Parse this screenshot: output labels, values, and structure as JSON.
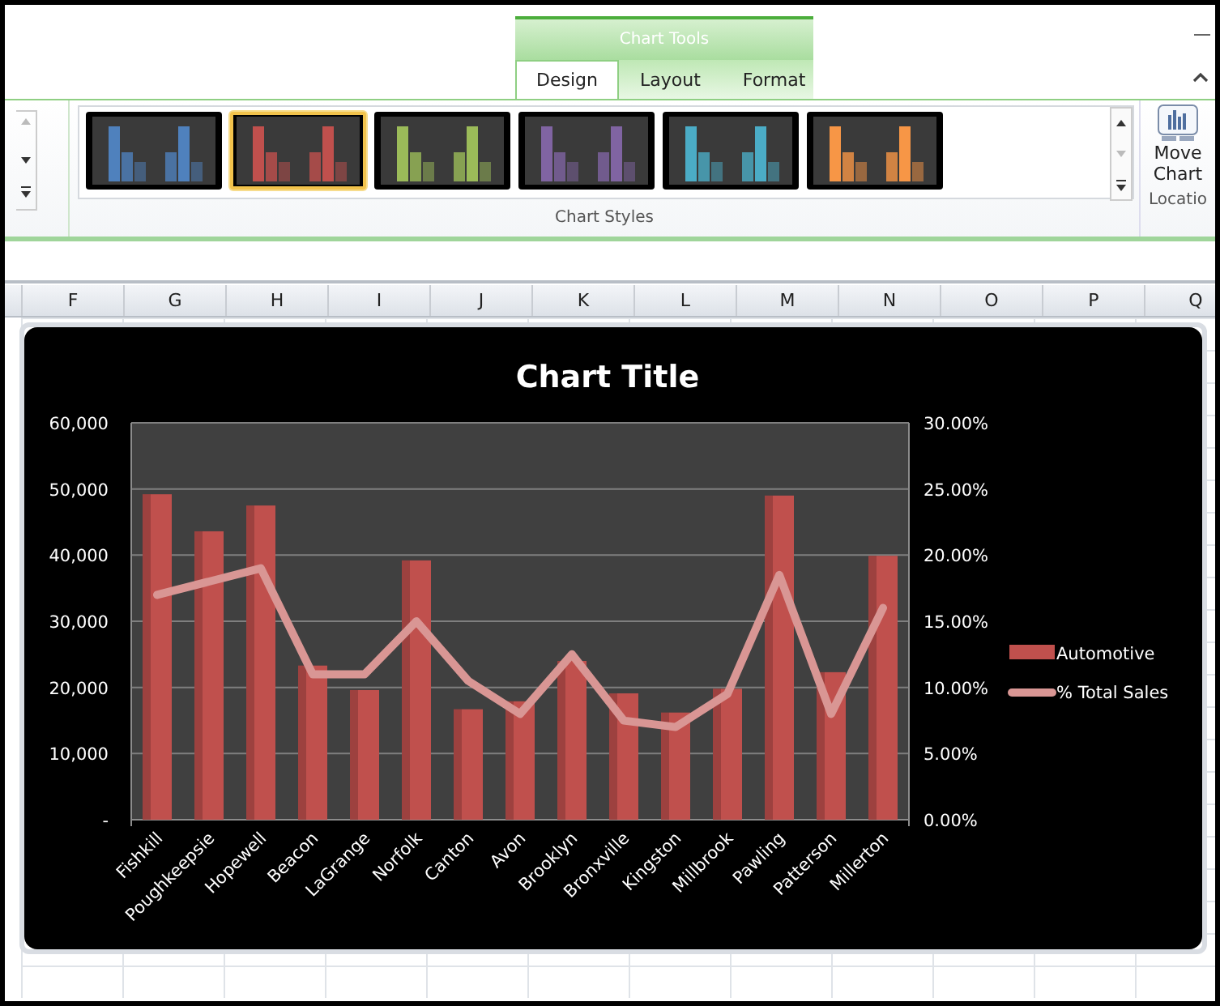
{
  "ribbon": {
    "contextual_title": "Chart Tools",
    "tabs": [
      {
        "label": "Design",
        "selected": true
      },
      {
        "label": "Layout",
        "selected": false
      },
      {
        "label": "Format",
        "selected": false
      }
    ],
    "chart_styles": [
      {
        "color": "#4f81bd",
        "selected": false
      },
      {
        "color": "#c0504d",
        "selected": true
      },
      {
        "color": "#9bbb59",
        "selected": false
      },
      {
        "color": "#8064a2",
        "selected": false
      },
      {
        "color": "#4bacc6",
        "selected": false
      },
      {
        "color": "#f79646",
        "selected": false
      }
    ],
    "group_label": "Chart Styles",
    "move_chart_label": "Move Chart",
    "location_group_label": "Locatio"
  },
  "columns": [
    "F",
    "G",
    "H",
    "I",
    "J",
    "K",
    "L",
    "M",
    "N",
    "O",
    "P",
    "Q"
  ],
  "chart": {
    "chart_data": {
      "type": "bar",
      "title": "Chart Title",
      "categories": [
        "Fishkill",
        "Poughkeepsie",
        "Hopewell",
        "Beacon",
        "LaGrange",
        "Norfolk",
        "Canton",
        "Avon",
        "Brooklyn",
        "Bronxville",
        "Kingston",
        "Millbrook",
        "Pawling",
        "Patterson",
        "Millerton"
      ],
      "grid": true,
      "legend": true,
      "series": [
        {
          "name": "Automotive",
          "color": "#c0504d",
          "values": [
            49200,
            43600,
            47500,
            23300,
            19600,
            39200,
            16700,
            17900,
            24000,
            19100,
            16200,
            19800,
            49000,
            22300,
            39900
          ]
        },
        {
          "name": "% Total Sales",
          "type": "line",
          "axis": "y2",
          "color": "#d99694",
          "values": [
            0.17,
            0.18,
            0.19,
            0.11,
            0.11,
            0.15,
            0.105,
            0.08,
            0.125,
            0.075,
            0.07,
            0.095,
            0.185,
            0.08,
            0.16
          ]
        }
      ],
      "ylim": [
        0,
        60000
      ],
      "yticks": [
        {
          "value": 0,
          "label": "-"
        },
        {
          "value": 10000,
          "label": "10,000"
        },
        {
          "value": 20000,
          "label": "20,000"
        },
        {
          "value": 30000,
          "label": "30,000"
        },
        {
          "value": 40000,
          "label": "40,000"
        },
        {
          "value": 50000,
          "label": "50,000"
        },
        {
          "value": 60000,
          "label": "60,000"
        }
      ],
      "y2lim": [
        0,
        0.3
      ],
      "y2ticks": [
        {
          "value": 0,
          "label": "0.00%"
        },
        {
          "value": 0.05,
          "label": "5.00%"
        },
        {
          "value": 0.1,
          "label": "10.00%"
        },
        {
          "value": 0.15,
          "label": "15.00%"
        },
        {
          "value": 0.2,
          "label": "20.00%"
        },
        {
          "value": 0.25,
          "label": "25.00%"
        },
        {
          "value": 0.3,
          "label": "30.00%"
        }
      ]
    }
  }
}
